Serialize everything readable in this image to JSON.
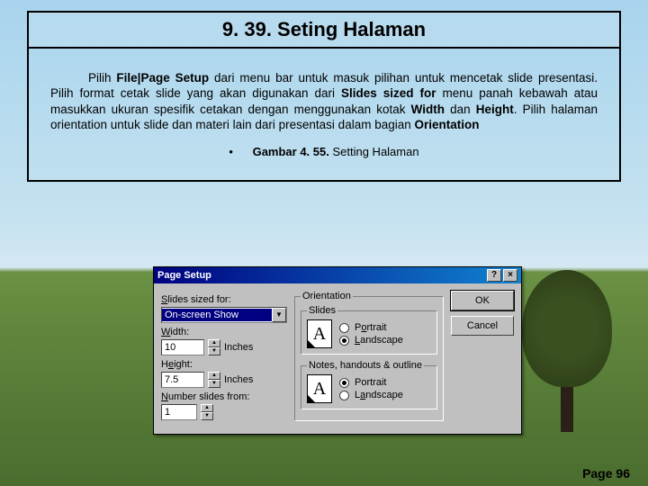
{
  "title": "9. 39. Seting Halaman",
  "paragraph_parts": {
    "p1": "Pilih ",
    "b1": "File|Page Setup",
    "p2": " dari menu bar untuk masuk pilihan untuk mencetak slide presentasi. Pilih format cetak slide yang akan digunakan dari ",
    "b2": "Slides sized for",
    "p3": " menu panah kebawah atau masukkan ukuran spesifik cetakan dengan menggunakan kotak ",
    "b3": "Width",
    "p4": " dan ",
    "b4": "Height",
    "p5": ". Pilih halaman orientation untuk slide dan materi lain dari presentasi dalam bagian ",
    "b5": "Orientation"
  },
  "caption_bold": "Gambar 4. 55.",
  "caption_rest": " Setting Halaman",
  "page_number": "Page 96",
  "dialog": {
    "title": "Page Setup",
    "help": "?",
    "close": "×",
    "slides_sized_label_u": "S",
    "slides_sized_label": "lides sized for:",
    "slides_sized_value": "On-screen Show",
    "width_label_u": "W",
    "width_label": "idth:",
    "width_value": "10",
    "height_label_u": "H",
    "height_label_pre": "",
    "height_label": "eight:",
    "height_value": "7.5",
    "inches": "Inches",
    "number_label_u": "N",
    "number_label": "umber slides from:",
    "number_value": "1",
    "orientation_legend": "Orientation",
    "slides_legend": "Slides",
    "notes_legend": "Notes, handouts & outline",
    "portrait": "Portrait",
    "landscape": "Landscape",
    "icon_letter": "A",
    "ok": "OK",
    "cancel": "Cancel"
  }
}
